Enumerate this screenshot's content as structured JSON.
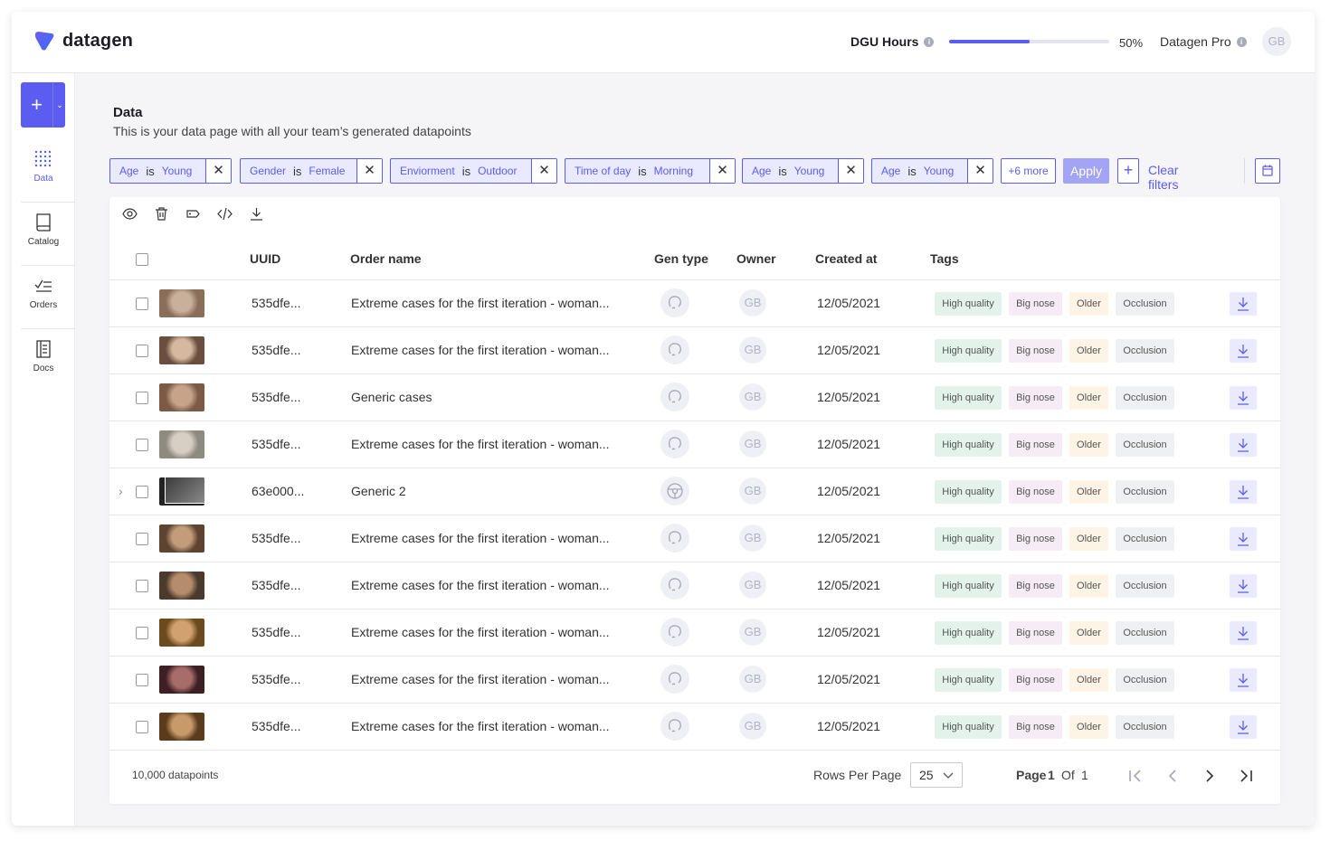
{
  "header": {
    "logo_text": "datagen",
    "dgu_label": "DGU Hours",
    "dgu_progress": 0.5,
    "dgu_percent": "50%",
    "plan_label": "Datagen Pro",
    "avatar_initials": "GB"
  },
  "sidebar": {
    "items": [
      {
        "label": "Data",
        "icon": "grid-dots-icon",
        "active": true
      },
      {
        "label": "Catalog",
        "icon": "book-icon",
        "active": false
      },
      {
        "label": "Orders",
        "icon": "checklist-icon",
        "active": false
      },
      {
        "label": "Docs",
        "icon": "document-icon",
        "active": false
      }
    ]
  },
  "page": {
    "title": "Data",
    "subtitle": "This is your data page with all your team’s generated datapoints"
  },
  "filters": {
    "chips": [
      {
        "field": "Age",
        "op": "is",
        "value": "Young"
      },
      {
        "field": "Gender",
        "op": "is",
        "value": "Female"
      },
      {
        "field": "Enviorment",
        "op": "is",
        "value": "Outdoor"
      },
      {
        "field": "Time of day",
        "op": "is",
        "value": "Morning"
      },
      {
        "field": "Age",
        "op": "is",
        "value": "Young"
      },
      {
        "field": "Age",
        "op": "is",
        "value": "Young"
      }
    ],
    "more_label": "+6 more",
    "apply_label": "Apply",
    "clear_label": "Clear filters"
  },
  "table": {
    "columns": [
      "UUID",
      "Order name",
      "Gen type",
      "Owner",
      "Created at",
      "Tags"
    ],
    "rows": [
      {
        "uuid": "535dfe...",
        "order": "Extreme cases for the first iteration - woman...",
        "owner": "GB",
        "created": "12/05/2021",
        "expandable": false
      },
      {
        "uuid": "535dfe...",
        "order": "Extreme cases for the first iteration - woman...",
        "owner": "GB",
        "created": "12/05/2021",
        "expandable": false
      },
      {
        "uuid": "535dfe...",
        "order": "Generic cases",
        "owner": "GB",
        "created": "12/05/2021",
        "expandable": false
      },
      {
        "uuid": "535dfe...",
        "order": "Extreme cases for the first iteration - woman...",
        "owner": "GB",
        "created": "12/05/2021",
        "expandable": false
      },
      {
        "uuid": "63e000...",
        "order": "Generic 2",
        "owner": "GB",
        "created": "12/05/2021",
        "expandable": true
      },
      {
        "uuid": "535dfe...",
        "order": "Extreme cases for the first iteration - woman...",
        "owner": "GB",
        "created": "12/05/2021",
        "expandable": false
      },
      {
        "uuid": "535dfe...",
        "order": "Extreme cases for the first iteration - woman...",
        "owner": "GB",
        "created": "12/05/2021",
        "expandable": false
      },
      {
        "uuid": "535dfe...",
        "order": "Extreme cases for the first iteration - woman...",
        "owner": "GB",
        "created": "12/05/2021",
        "expandable": false
      },
      {
        "uuid": "535dfe...",
        "order": "Extreme cases for the first iteration - woman...",
        "owner": "GB",
        "created": "12/05/2021",
        "expandable": false
      },
      {
        "uuid": "535dfe...",
        "order": "Extreme cases for the first iteration - woman...",
        "owner": "GB",
        "created": "12/05/2021",
        "expandable": false
      }
    ],
    "tags": [
      {
        "label": "High quality",
        "bg": "#e3f3ec"
      },
      {
        "label": "Big nose",
        "bg": "#f5ecf5"
      },
      {
        "label": "Older",
        "bg": "#fdf4e6"
      },
      {
        "label": "Occlusion",
        "bg": "#eef0f3"
      }
    ]
  },
  "footer": {
    "count": "10,000 datapoints",
    "rows_per_page_label": "Rows Per Page",
    "rows_per_page_value": "25",
    "page_label": "Page",
    "page_current": "1",
    "page_of": "Of",
    "page_total": "1"
  },
  "colors": {
    "accent": "#5b5cf0",
    "accent_light": "#eaeaff"
  }
}
